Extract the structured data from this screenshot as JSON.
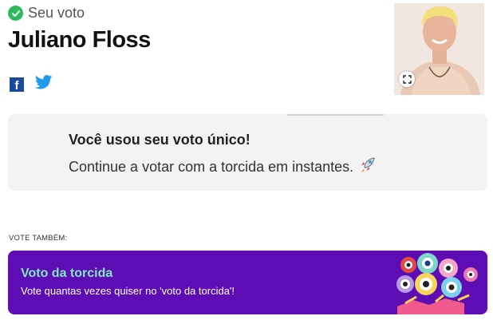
{
  "header": {
    "status_label": "Seu voto",
    "candidate_name": "Juliano Floss"
  },
  "social": {
    "facebook_letter": "f"
  },
  "notice": {
    "title": "Você usou seu voto único!",
    "text": "Continue a votar com a torcida em instantes."
  },
  "section_label": "VOTE TAMBÉM:",
  "banner": {
    "title": "Voto da torcida",
    "text": "Vote quantas vezes quiser no 'voto da torcida'!"
  },
  "colors": {
    "check": "#2dba5a",
    "facebook": "#1a4a9b",
    "twitter": "#1d9bf0",
    "banner_bg": "#5d0db3",
    "banner_title": "#7fe9c4"
  },
  "icons": [
    "check-circle-icon",
    "facebook-icon",
    "twitter-icon",
    "expand-icon",
    "rocket-icon"
  ]
}
